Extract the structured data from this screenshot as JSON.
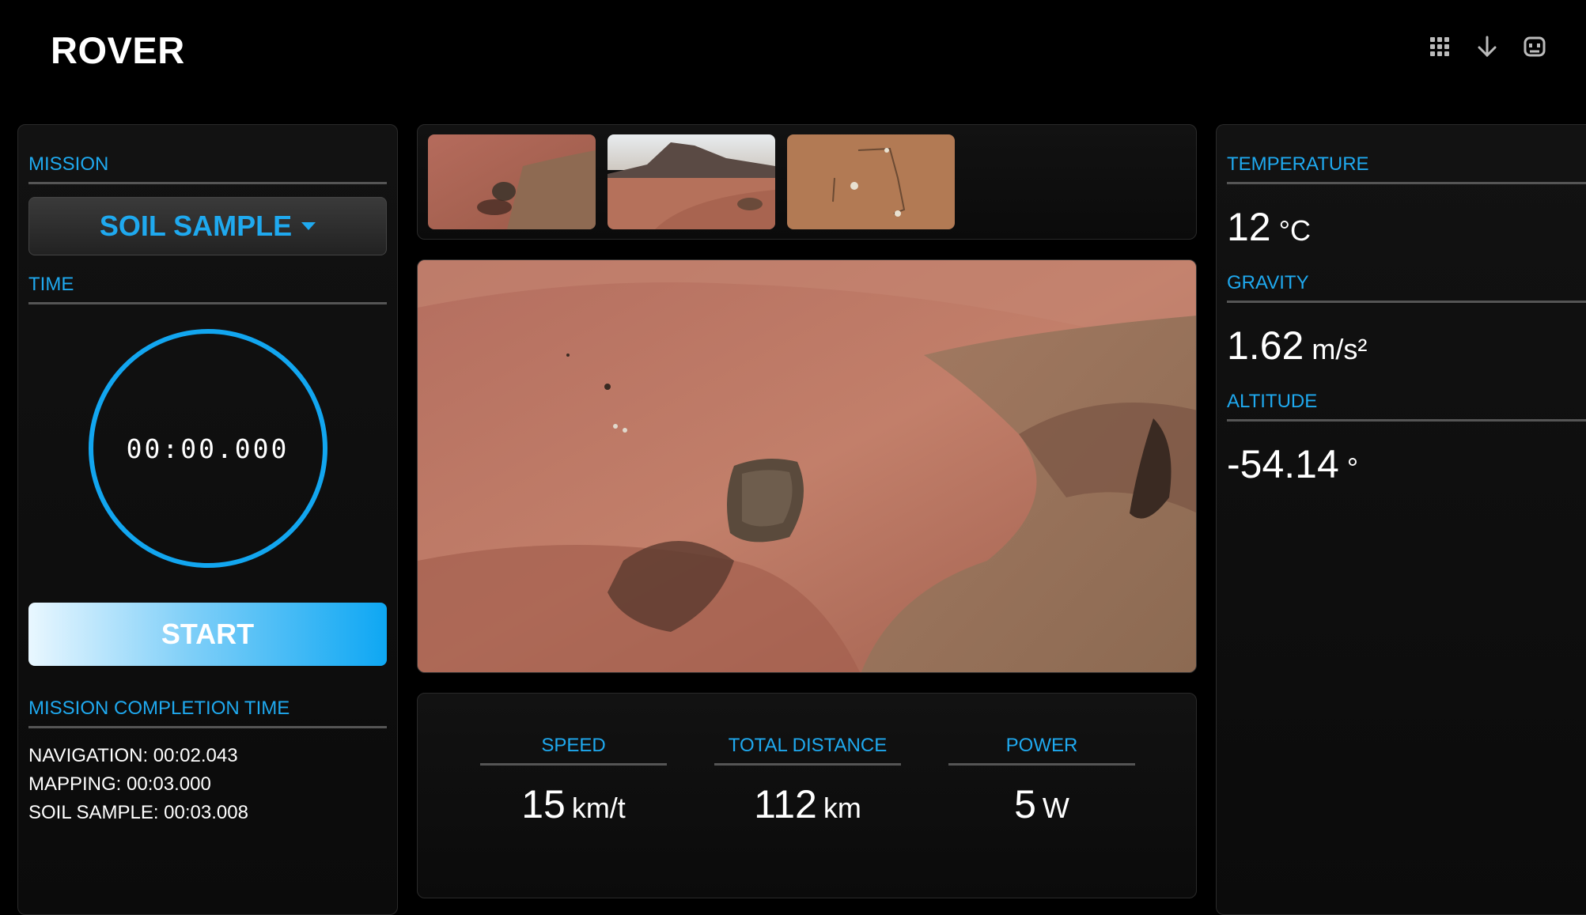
{
  "app": {
    "title": "ROVER"
  },
  "toolbar": {
    "icons": [
      "apps-grid-icon",
      "download-arrow-icon",
      "robot-icon"
    ]
  },
  "mission": {
    "label": "MISSION",
    "selected": "SOIL SAMPLE",
    "time_label": "TIME",
    "timer": "00:00.000",
    "start_label": "START",
    "completion_label": "MISSION COMPLETION TIME",
    "completion": [
      "NAVIGATION: 00:02.043",
      "MAPPING: 00:03.000",
      "SOIL SAMPLE: 00:03.008"
    ]
  },
  "stats": [
    {
      "label": "SPEED",
      "value": "15",
      "unit": "km/t"
    },
    {
      "label": "TOTAL DISTANCE",
      "value": "112",
      "unit": "km"
    },
    {
      "label": "POWER",
      "value": "5",
      "unit": "W"
    }
  ],
  "sensors": {
    "temperature_label": "TEMPERATURE",
    "temperature_value": "12",
    "temperature_unit": "°C",
    "gravity_label": "GRAVITY",
    "gravity_value": "1.62",
    "gravity_unit": "m/s²",
    "altitude_label": "ALTITUDE",
    "altitude_value": "-54.14",
    "altitude_unit": "°"
  },
  "colors": {
    "accent": "#1fa9ef",
    "background": "#000000",
    "panel": "#111111"
  }
}
